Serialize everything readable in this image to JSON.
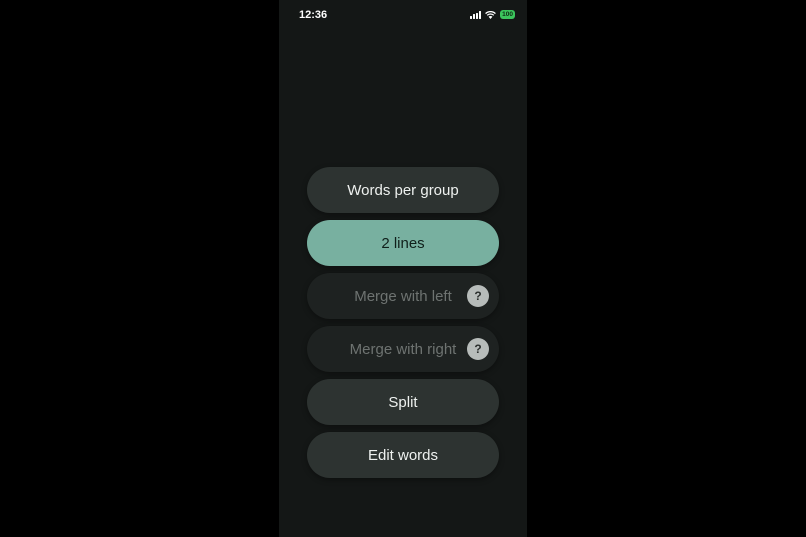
{
  "status_bar": {
    "time": "12:36",
    "battery": "100",
    "icons": [
      "signal-icon",
      "wifi-icon",
      "battery-icon"
    ],
    "battery_color": "#3bc45c"
  },
  "menu": {
    "items": [
      {
        "label": "Words per group",
        "state": "normal"
      },
      {
        "label": "2 lines",
        "state": "active"
      },
      {
        "label": "Merge with left",
        "state": "disabled",
        "help": "?"
      },
      {
        "label": "Merge with right",
        "state": "disabled",
        "help": "?"
      },
      {
        "label": "Split",
        "state": "normal"
      },
      {
        "label": "Edit words",
        "state": "normal"
      }
    ]
  },
  "colors": {
    "background": "#141716",
    "button": "#2d3331",
    "button_active": "#78b0a0",
    "button_disabled": "#1e2221"
  }
}
